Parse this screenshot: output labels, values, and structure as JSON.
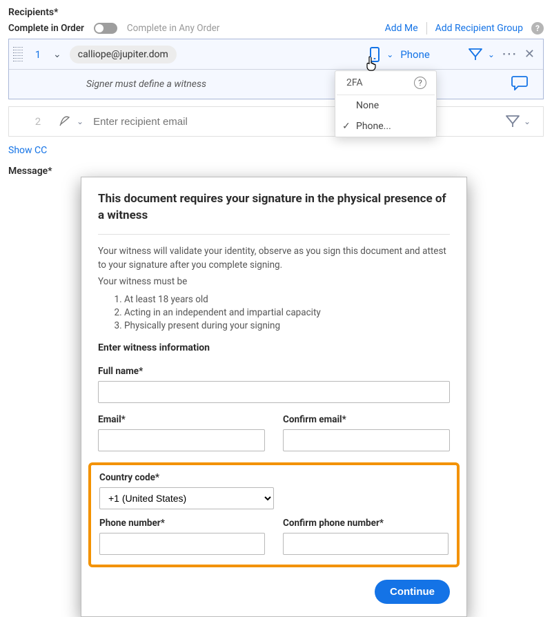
{
  "recipients": {
    "section_label": "Recipients",
    "complete_in_order": "Complete in Order",
    "complete_any_order": "Complete in Any Order",
    "add_me": "Add Me",
    "add_recipient_group": "Add Recipient Group",
    "row1": {
      "number": "1",
      "email": "calliope@jupiter.dom",
      "phone_label": "Phone",
      "witness_note": "Signer must define a witness",
      "phone_select_label": "Phone"
    },
    "row2": {
      "number": "2",
      "placeholder": "Enter recipient email"
    },
    "dropdown": {
      "head": "2FA",
      "items": [
        "None",
        "Phone..."
      ],
      "selected_index": 1
    },
    "show_cc": "Show CC"
  },
  "message": {
    "section_label": "Message"
  },
  "modal": {
    "title": "This document requires your signature in the physical presence of a witness",
    "intro1": "Your witness will validate your identity, observe as you sign this document and attest to your signature after you complete signing.",
    "intro2": "Your witness must be",
    "reqs": [
      "At least 18 years old",
      "Acting in an independent and impartial capacity",
      "Physically present during your signing"
    ],
    "enter_info": "Enter witness information",
    "full_name_label": "Full name",
    "email_label": "Email",
    "confirm_email_label": "Confirm email",
    "country_label": "Country code",
    "country_value": "+1 (United States)",
    "phone_label": "Phone number",
    "confirm_phone_label": "Confirm phone number",
    "continue": "Continue"
  }
}
